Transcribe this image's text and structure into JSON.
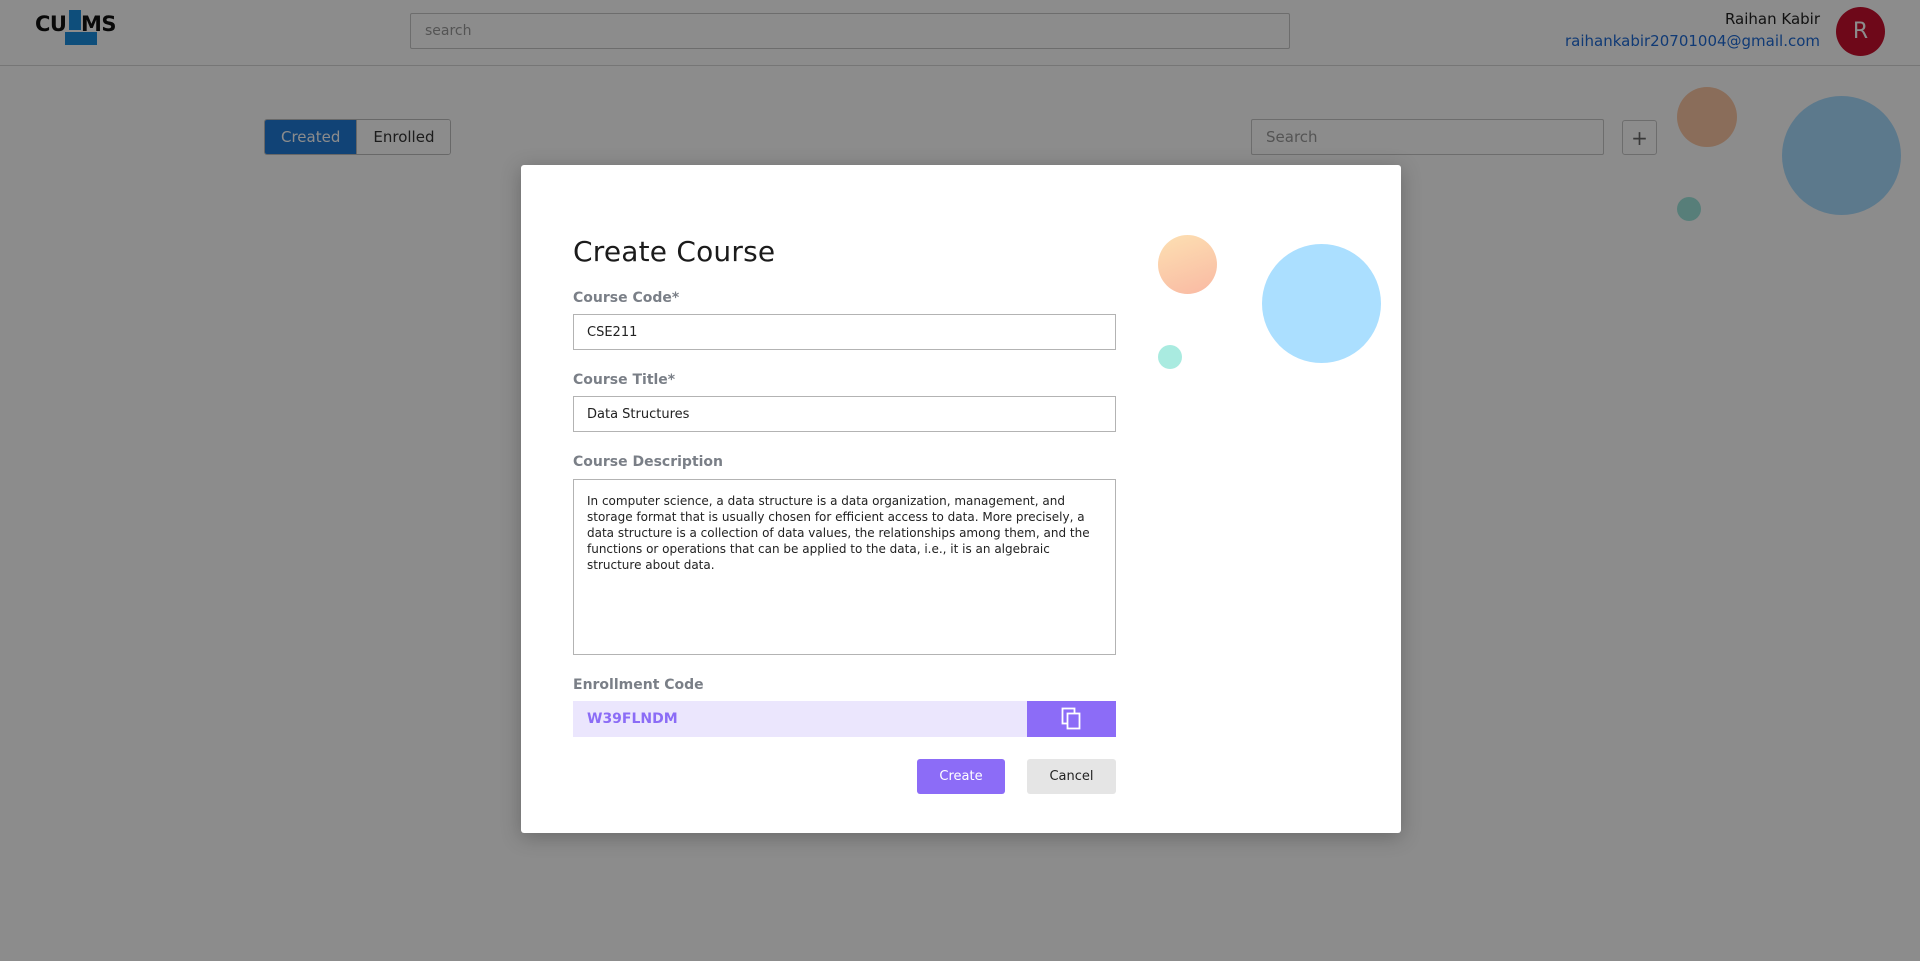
{
  "header": {
    "logo_left": "CU",
    "logo_right": "MS",
    "search_placeholder": "search",
    "user_name": "Raihan Kabir",
    "user_email": "raihankabir20701004@gmail.com",
    "avatar_initial": "R",
    "avatar_color": "#c8102e"
  },
  "toolbar": {
    "tabs": [
      {
        "label": "Created",
        "active": true
      },
      {
        "label": "Enrolled",
        "active": false
      }
    ],
    "search_placeholder": "Search",
    "add_icon": "plus-icon",
    "add_symbol": "+"
  },
  "modal": {
    "title": "Create Course",
    "course_code_label": "Course Code*",
    "course_code_value": "CSE211",
    "course_title_label": "Course Title*",
    "course_title_value": "Data Structures",
    "course_description_label": "Course Description",
    "course_description_value": "In computer science, a data structure is a data organization, management, and storage format that is usually chosen for efficient access to data. More precisely, a data structure is a collection of data values, the relationships among them, and the functions or operations that can be applied to the data, i.e., it is an algebraic structure about data.",
    "enrollment_code_label": "Enrollment Code",
    "enrollment_code_value": "W39FLNDM",
    "copy_icon": "copy-icon",
    "create_label": "Create",
    "cancel_label": "Cancel"
  },
  "colors": {
    "primary_blue": "#1f7ad8",
    "accent_purple": "#8c6cf7",
    "enroll_bg": "#ebe6fd",
    "bubble_orange": "#fbc7a4",
    "bubble_blue": "#a8dcff",
    "bubble_teal": "#9ee6dc"
  }
}
